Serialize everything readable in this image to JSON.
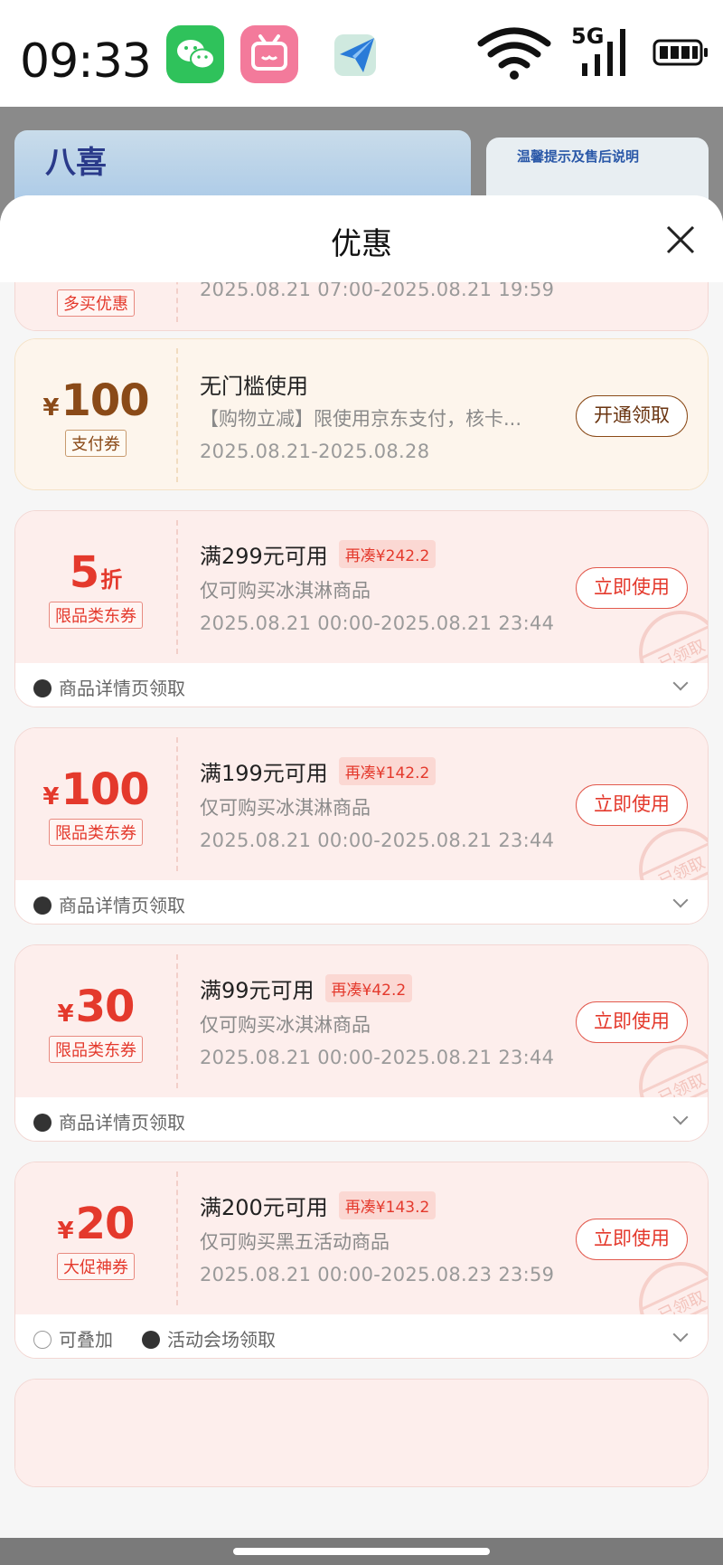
{
  "status_bar": {
    "time": "09:33",
    "icons": [
      "wechat-icon",
      "bilibili-icon",
      "send-app-icon",
      "wifi-icon",
      "5g-signal-icon",
      "battery-icon"
    ],
    "network": "5G"
  },
  "background": {
    "banner_brand": "八喜",
    "notice_title": "温馨提示及售后说明"
  },
  "sheet": {
    "title": "优惠",
    "close_icon": "close-icon"
  },
  "coupons": [
    {
      "tag": "多买优惠",
      "date": "2025.08.21 07:00-2025.08.21 19:59"
    },
    {
      "yen": "¥",
      "amount": "100",
      "tag": "支付券",
      "condition": "无门槛使用",
      "desc": "【购物立减】限使用京东支付，核卡...",
      "date": "2025.08.21-2025.08.28",
      "button": "开通领取"
    },
    {
      "amount": "5",
      "unit": "折",
      "tag": "限品类东券",
      "condition": "满299元可用",
      "need": "再凑¥242.2",
      "desc": "仅可购买冰淇淋商品",
      "date": "2025.08.21 00:00-2025.08.21 23:44",
      "button": "立即使用",
      "stamp": "已领取",
      "footer": "商品详情页领取"
    },
    {
      "yen": "¥",
      "amount": "100",
      "tag": "限品类东券",
      "condition": "满199元可用",
      "need": "再凑¥142.2",
      "desc": "仅可购买冰淇淋商品",
      "date": "2025.08.21 00:00-2025.08.21 23:44",
      "button": "立即使用",
      "stamp": "已领取",
      "footer": "商品详情页领取"
    },
    {
      "yen": "¥",
      "amount": "30",
      "tag": "限品类东券",
      "condition": "满99元可用",
      "need": "再凑¥42.2",
      "desc": "仅可购买冰淇淋商品",
      "date": "2025.08.21 00:00-2025.08.21 23:44",
      "button": "立即使用",
      "stamp": "已领取",
      "footer": "商品详情页领取"
    },
    {
      "yen": "¥",
      "amount": "20",
      "tag": "大促神券",
      "condition": "满200元可用",
      "need": "再凑¥143.2",
      "desc": "仅可购买黑五活动商品",
      "date": "2025.08.21 00:00-2025.08.23 23:59",
      "button": "立即使用",
      "stamp": "已领取",
      "footer_stack": "可叠加",
      "footer": "活动会场领取"
    }
  ]
}
